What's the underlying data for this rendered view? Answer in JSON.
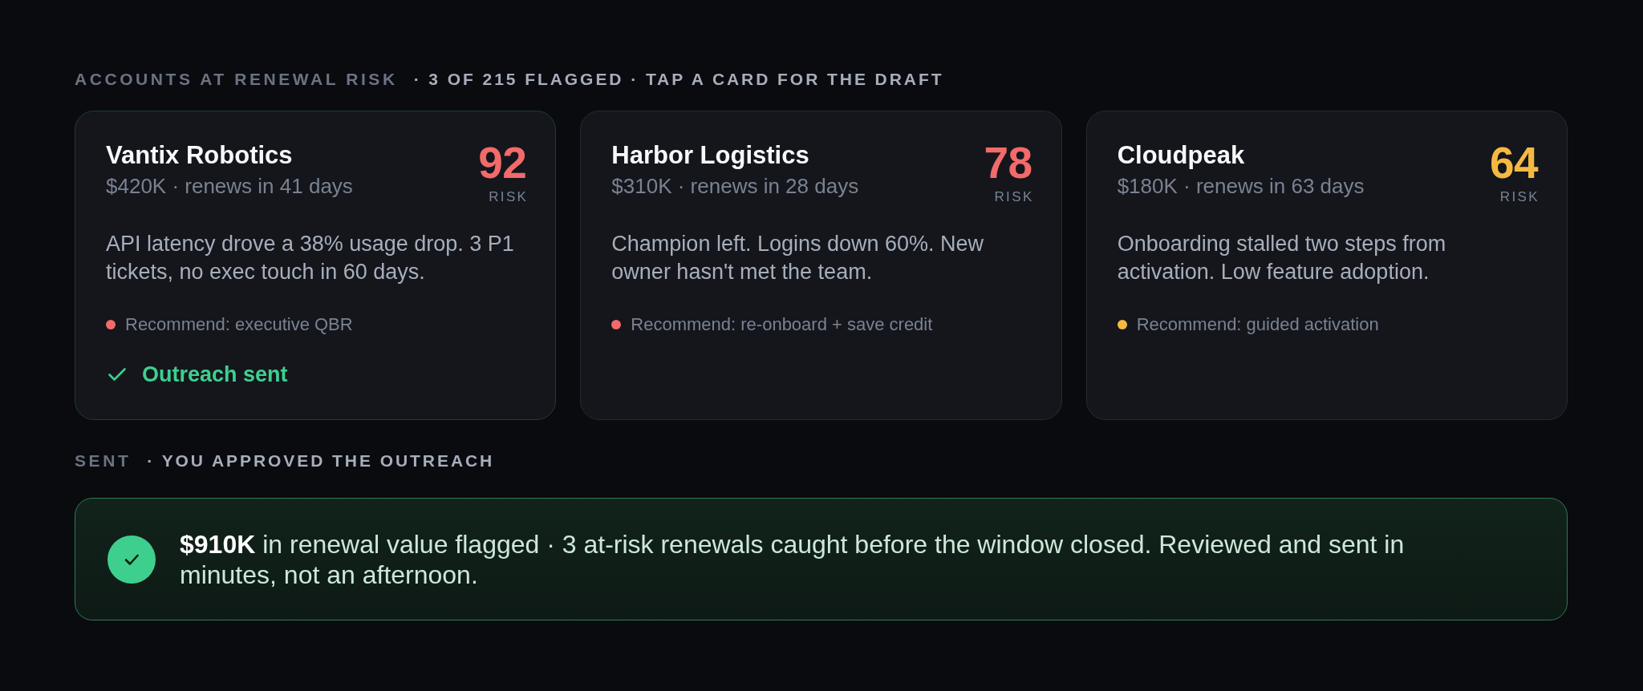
{
  "accounts_section": {
    "title": "ACCOUNTS AT RENEWAL RISK",
    "subtitle": "· 3 OF 215 FLAGGED · TAP A CARD FOR THE DRAFT"
  },
  "cards": [
    {
      "name": "Vantix Robotics",
      "meta": "$420K · renews in 41 days",
      "risk_score": "92",
      "risk_label": "RISK",
      "color": "#f26a6a",
      "description": "API latency drove a 38% usage drop. 3 P1 tickets, no exec touch in 60 days.",
      "recommendation": "Recommend: executive QBR",
      "sent": true,
      "status": "Outreach sent"
    },
    {
      "name": "Harbor Logistics",
      "meta": "$310K · renews in 28 days",
      "risk_score": "78",
      "risk_label": "RISK",
      "color": "#f26a6a",
      "description": "Champion left. Logins down 60%. New owner hasn't met the team.",
      "recommendation": "Recommend: re-onboard + save credit",
      "sent": false
    },
    {
      "name": "Cloudpeak",
      "meta": "$180K · renews in 63 days",
      "risk_score": "64",
      "risk_label": "RISK",
      "color": "#f5b942",
      "description": "Onboarding stalled two steps from activation. Low feature adoption.",
      "recommendation": "Recommend: guided activation",
      "sent": false
    }
  ],
  "sent_section": {
    "title": "SENT",
    "subtitle": "· YOU APPROVED THE OUTREACH"
  },
  "summary": {
    "text": "**$910K** in renewal value flagged · 3 at-risk renewals caught before the window closed. Reviewed and sent in minutes, not an afternoon."
  }
}
